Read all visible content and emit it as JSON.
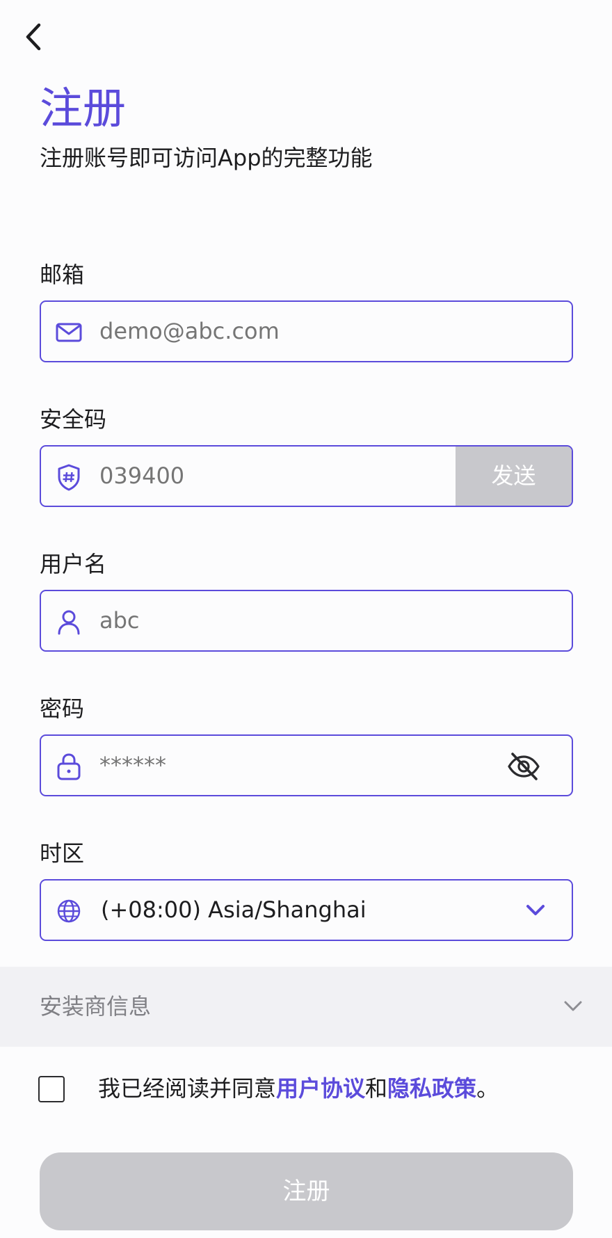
{
  "header": {
    "back_icon": "chevron-left-icon",
    "title": "注册",
    "subtitle": "注册账号即可访问App的完整功能"
  },
  "form": {
    "email": {
      "label": "邮箱",
      "placeholder": "demo@abc.com",
      "icon": "mail-icon"
    },
    "security_code": {
      "label": "安全码",
      "placeholder": "039400",
      "icon": "shield-hash-icon",
      "send_label": "发送"
    },
    "username": {
      "label": "用户名",
      "placeholder": "abc",
      "icon": "user-icon"
    },
    "password": {
      "label": "密码",
      "placeholder": "******",
      "icon": "lock-icon",
      "toggle_icon": "eye-off-icon"
    },
    "timezone": {
      "label": "时区",
      "value": "(+08:00) Asia/Shanghai",
      "icon": "globe-icon",
      "dropdown_icon": "chevron-down-icon"
    }
  },
  "installer": {
    "label": "安装商信息",
    "icon": "chevron-down-icon"
  },
  "agreement": {
    "prefix": "我已经阅读并同意",
    "terms_link": "用户协议",
    "and": "和",
    "privacy_link": "隐私政策",
    "suffix": "。",
    "checked": false
  },
  "submit_label": "注册",
  "colors": {
    "accent": "#5b4bdb",
    "disabled": "#c8c8cc",
    "placeholder": "#c4c4c8",
    "section_bg": "#f1f1f4"
  }
}
